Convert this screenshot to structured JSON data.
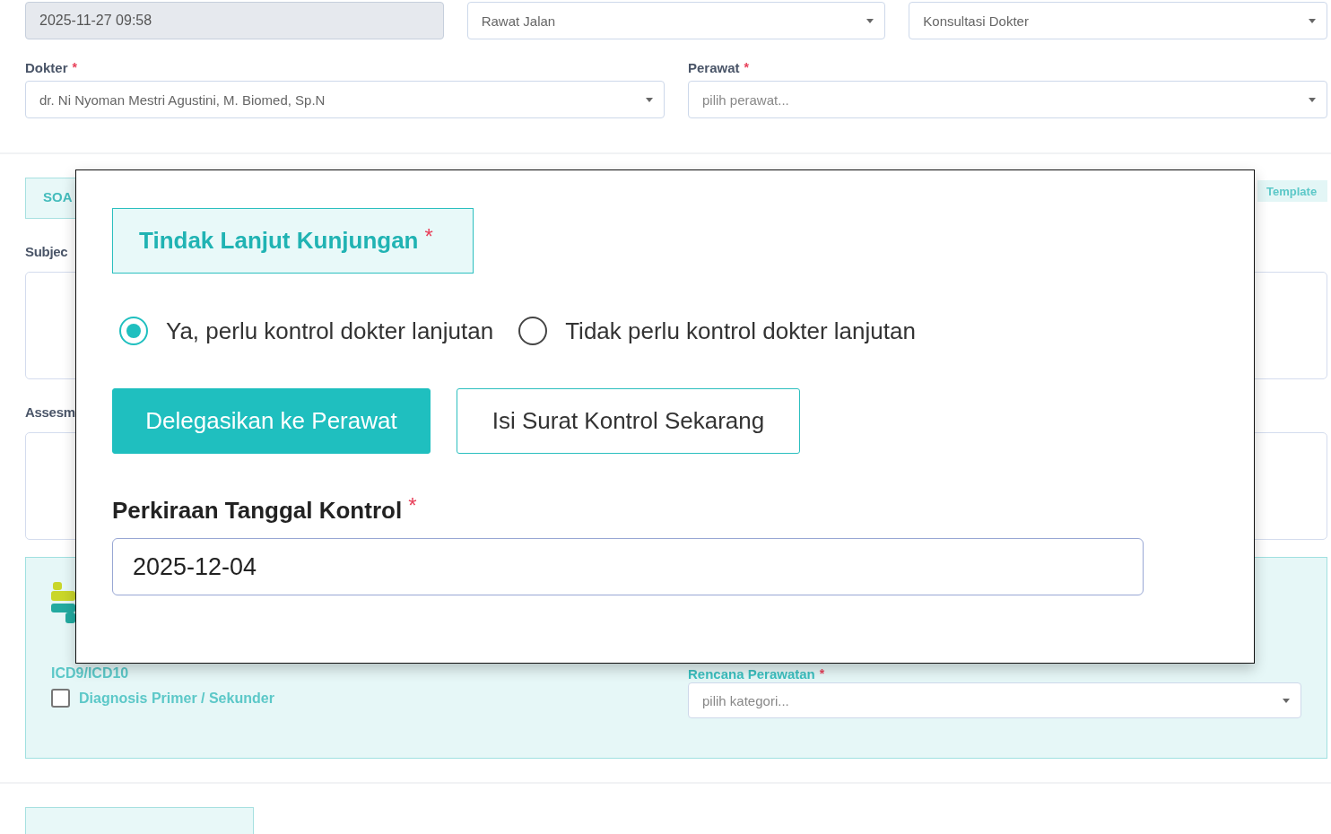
{
  "background": {
    "top_fields": [
      {
        "kind": "readonly",
        "value": "2025-11-27 09:58"
      },
      {
        "kind": "select",
        "value": "Rawat Jalan"
      },
      {
        "kind": "select",
        "value": "Konsultasi Dokter"
      }
    ],
    "staff_fields": [
      {
        "label": "Dokter",
        "required_mark": "*",
        "value": "dr. Ni Nyoman Mestri Agustini, M. Biomed, Sp.N"
      },
      {
        "label": "Perawat",
        "required_mark": "*",
        "placeholder": "pilih perawat..."
      }
    ],
    "soap_tab": "SOA",
    "template_button": "Template",
    "textareas": [
      {
        "label": "Subjec"
      },
      {
        "label": "Assesm"
      }
    ],
    "diagnosis_panel": {
      "code_label": "ICD9/ICD10",
      "checkbox": {
        "label": "Diagnosis Primer / Sekunder",
        "checked": false
      },
      "plan_field": {
        "label": "Rencana Perawatan",
        "required_mark": "*",
        "placeholder": "pilih kategori..."
      }
    }
  },
  "modal": {
    "title": "Tindak Lanjut Kunjungan",
    "title_mark": "*",
    "options": [
      {
        "label": "Ya, perlu kontrol dokter lanjutan",
        "selected": true
      },
      {
        "label": "Tidak perlu kontrol dokter lanjutan",
        "selected": false
      }
    ],
    "buttons": [
      {
        "label": "Delegasikan ke Perawat",
        "kind": "primary"
      },
      {
        "label": "Isi Surat Kontrol Sekarang",
        "kind": "outline"
      }
    ],
    "date_field": {
      "label": "Perkiraan Tanggal Kontrol",
      "required_mark": "*",
      "value": "2025-12-04"
    }
  }
}
